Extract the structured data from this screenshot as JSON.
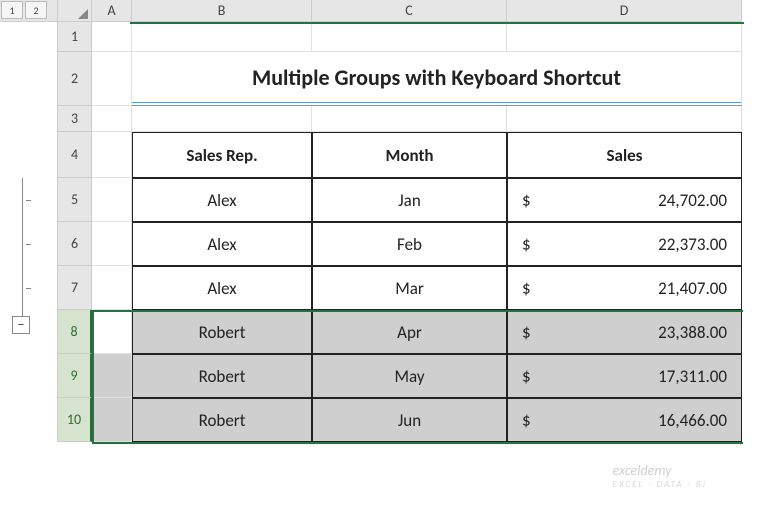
{
  "outline": {
    "level1": "1",
    "level2": "2",
    "collapse": "−"
  },
  "columns": {
    "A": "A",
    "B": "B",
    "C": "C",
    "D": "D"
  },
  "rows": {
    "r1": "1",
    "r2": "2",
    "r3": "3",
    "r4": "4",
    "r5": "5",
    "r6": "6",
    "r7": "7",
    "r8": "8",
    "r9": "9",
    "r10": "10"
  },
  "title": "Multiple Groups with Keyboard Shortcut",
  "headers": {
    "rep": "Sales Rep.",
    "month": "Month",
    "sales": "Sales"
  },
  "currency": "$",
  "table": [
    {
      "rep": "Alex",
      "month": "Jan",
      "sales": "24,702.00"
    },
    {
      "rep": "Alex",
      "month": "Feb",
      "sales": "22,373.00"
    },
    {
      "rep": "Alex",
      "month": "Mar",
      "sales": "21,407.00"
    },
    {
      "rep": "Robert",
      "month": "Apr",
      "sales": "23,388.00"
    },
    {
      "rep": "Robert",
      "month": "May",
      "sales": "17,311.00"
    },
    {
      "rep": "Robert",
      "month": "Jun",
      "sales": "16,466.00"
    }
  ],
  "watermark": {
    "main": "exceldemy",
    "sub": "EXCEL · DATA · BI"
  },
  "chart_data": {
    "type": "table",
    "title": "Multiple Groups with Keyboard Shortcut",
    "columns": [
      "Sales Rep.",
      "Month",
      "Sales"
    ],
    "rows": [
      [
        "Alex",
        "Jan",
        24702.0
      ],
      [
        "Alex",
        "Feb",
        22373.0
      ],
      [
        "Alex",
        "Mar",
        21407.0
      ],
      [
        "Robert",
        "Apr",
        23388.0
      ],
      [
        "Robert",
        "May",
        17311.0
      ],
      [
        "Robert",
        "Jun",
        16466.0
      ]
    ]
  }
}
